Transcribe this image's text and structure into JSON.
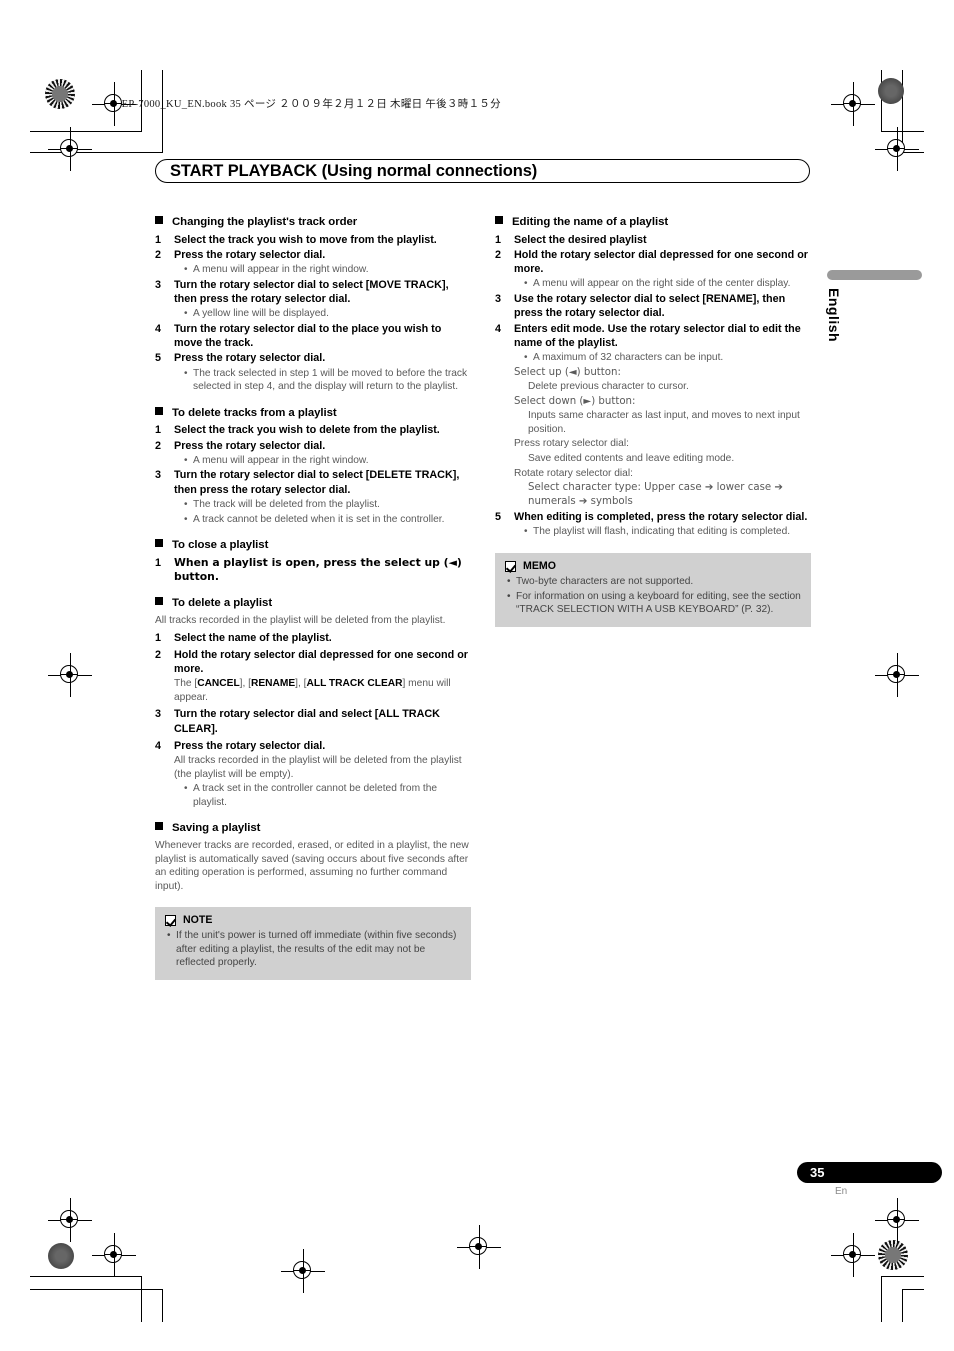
{
  "header": {
    "print_info": "MEP-7000_KU_EN.book   35 ページ   ２００９年２月１２日   木曜日   午後３時１５分"
  },
  "title": {
    "text": "START PLAYBACK (Using normal connections)"
  },
  "side_tab": {
    "label": "English",
    "bar_color": "#9a9a9a"
  },
  "footer": {
    "page_number": "35",
    "language_code": "En"
  },
  "left_column": {
    "sections": [
      {
        "heading": "Changing the playlist's track order",
        "steps": [
          {
            "num": "1",
            "text": "Select the track you wish to move from the playlist."
          },
          {
            "num": "2",
            "text": "Press the rotary selector dial."
          },
          {
            "num": "3",
            "text": "Turn the rotary selector dial to select [MOVE TRACK], then press the rotary selector dial."
          },
          {
            "num": "4",
            "text": "Turn the rotary selector dial to the place you wish to move the track."
          },
          {
            "num": "5",
            "text": "Press the rotary selector dial."
          }
        ],
        "bullets": {
          "b1": "A menu will appear in the right window.",
          "b2": "A yellow line will be displayed.",
          "b3": "The track selected in step 1 will be moved to before the track selected in step 4, and the display will return to the playlist."
        }
      },
      {
        "heading": "To delete tracks from a playlist",
        "steps": [
          {
            "num": "1",
            "text": "Select the track you wish to delete from the playlist."
          },
          {
            "num": "2",
            "text": "Press the rotary selector dial."
          },
          {
            "num": "3",
            "text": "Turn the rotary selector dial to select [DELETE TRACK], then press the rotary selector dial."
          }
        ],
        "bullets": {
          "b1": "A menu will appear in the right window.",
          "b2": "The track will be deleted from the playlist.",
          "b3": "A track cannot be deleted when it is set in the controller."
        }
      },
      {
        "heading": "To close a playlist",
        "steps": [
          {
            "num": "1",
            "text": "When a playlist is open, press the select up (◄) button."
          }
        ]
      },
      {
        "heading": "To delete a playlist",
        "intro": "All tracks recorded in the playlist will be deleted from the playlist.",
        "steps": [
          {
            "num": "1",
            "text": "Select the name of the playlist."
          },
          {
            "num": "2",
            "text": "Hold the rotary selector dial depressed for one second or more."
          },
          {
            "num": "3",
            "text": "Turn the rotary selector dial and select [ALL TRACK CLEAR]."
          },
          {
            "num": "4",
            "text": "Press the rotary selector dial."
          }
        ],
        "menu_note_pre": "The [",
        "menu_cancel": "CANCEL",
        "menu_sep1": "], [",
        "menu_rename": "RENAME",
        "menu_sep2": "], [",
        "menu_all_track_clear": "ALL TRACK CLEAR",
        "menu_note_post": "] menu will appear.",
        "result_text": "All tracks recorded in the playlist will be deleted from the playlist (the playlist will be empty).",
        "bullet_after": "A track set in the controller cannot be deleted from the playlist."
      },
      {
        "heading": "Saving a playlist",
        "body": "Whenever tracks are recorded, erased, or edited in a playlist, the new playlist is automatically saved (saving occurs about five seconds after an editing operation is performed, assuming no further command input)."
      }
    ],
    "note_box": {
      "title": "NOTE",
      "icon": "checkbox-checked-icon",
      "bullets": [
        "If the unit's power is turned off immediate (within five seconds) after editing a playlist, the results of the edit may not be reflected properly."
      ]
    }
  },
  "right_column": {
    "section": {
      "heading": "Editing the name of a playlist",
      "steps": [
        {
          "num": "1",
          "text": "Select the desired playlist"
        },
        {
          "num": "2",
          "text": "Hold the rotary selector dial depressed for one second or more."
        },
        {
          "num": "3",
          "text": "Use the rotary selector dial to select [RENAME], then press the rotary selector dial."
        },
        {
          "num": "4",
          "text": "Enters edit mode. Use the rotary selector dial to edit the name of the playlist."
        },
        {
          "num": "5",
          "text": "When editing is completed, press the rotary selector dial."
        }
      ],
      "bullets": {
        "b1": "A menu will appear on the right side of the center display.",
        "b2": "A maximum of 32 characters can be input.",
        "b3": "The playlist will flash, indicating that editing is completed."
      },
      "dial_help": [
        {
          "label": "Select up (◄) button:",
          "desc": "Delete previous character to cursor."
        },
        {
          "label": "Select down (►) button:",
          "desc": "Inputs same character as last input, and moves to next input position."
        },
        {
          "label": "Press rotary selector dial:",
          "desc": "Save edited contents and leave editing mode."
        },
        {
          "label": "Rotate rotary selector dial:",
          "desc": "Select character type: Upper case ➔ lower case ➔ numerals ➔ symbols"
        }
      ]
    },
    "memo_box": {
      "title": "MEMO",
      "icon": "checkbox-checked-icon",
      "bullets": [
        "Two-byte characters are not supported.",
        "For information on using a keyboard for editing, see the section “TRACK SELECTION WITH A USB KEYBOARD” (P. 32)."
      ]
    }
  }
}
